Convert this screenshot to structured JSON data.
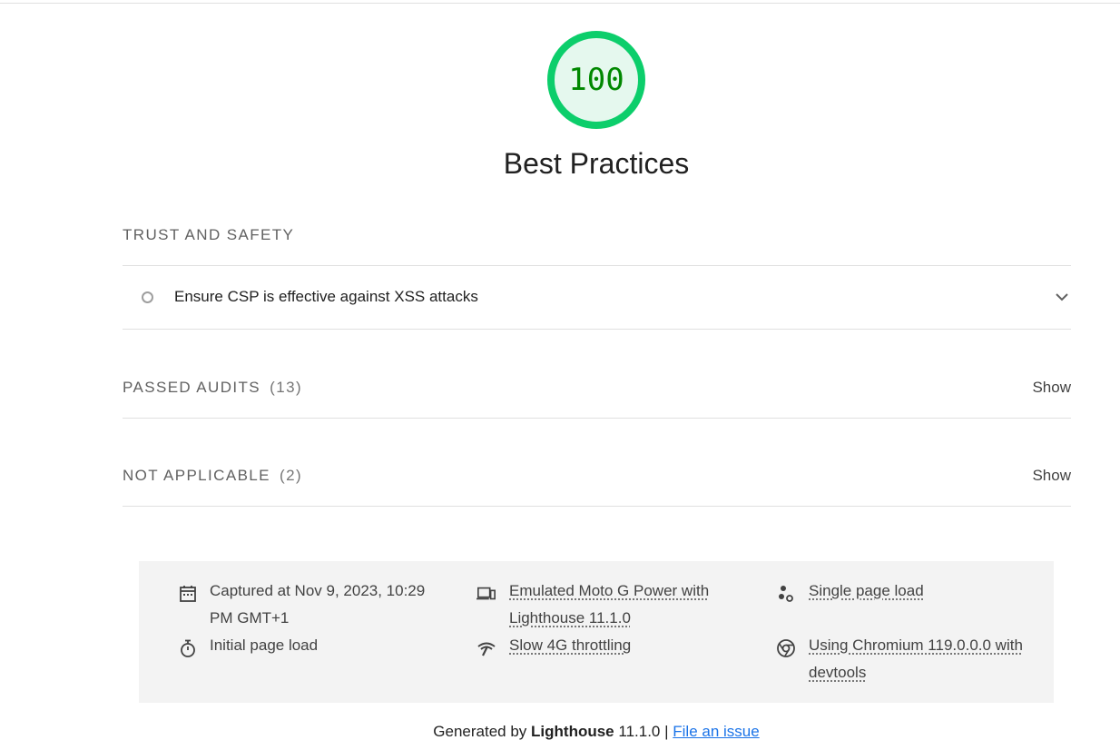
{
  "score": {
    "value": "100",
    "fraction": 1.0,
    "ring_color": "#0cce6b",
    "fill_color": "#e5f8ee",
    "text_color": "#008800"
  },
  "category": {
    "title": "Best Practices"
  },
  "sections": {
    "trust_safety": {
      "heading": "TRUST AND SAFETY",
      "audits": [
        {
          "title": "Ensure CSP is effective against XSS attacks",
          "marker": "informative-circle-icon"
        }
      ]
    },
    "passed": {
      "heading": "PASSED AUDITS",
      "count": "(13)",
      "toggle_label": "Show"
    },
    "not_applicable": {
      "heading": "NOT APPLICABLE",
      "count": "(2)",
      "toggle_label": "Show"
    }
  },
  "environment": {
    "captured": {
      "icon": "calendar-icon",
      "line1": "Captured at Nov 9, 2023, 10:29",
      "line2": "PM GMT+1"
    },
    "initial_load": {
      "icon": "stopwatch-icon",
      "text": "Initial page load"
    },
    "device": {
      "icon": "devices-icon",
      "line1": "Emulated Moto G Power with",
      "line2": "Lighthouse 11.1.0"
    },
    "throttling": {
      "icon": "network-icon",
      "text": "Slow 4G throttling"
    },
    "session": {
      "icon": "single-page-load-icon",
      "text": "Single page load"
    },
    "browser": {
      "icon": "chromium-icon",
      "line1": "Using Chromium 119.0.0.0 with",
      "line2": "devtools"
    }
  },
  "footer": {
    "generated_prefix": "Generated by",
    "tool_name": "Lighthouse",
    "version_suffix": "11.1.0 |",
    "issue_link": "File an issue"
  }
}
